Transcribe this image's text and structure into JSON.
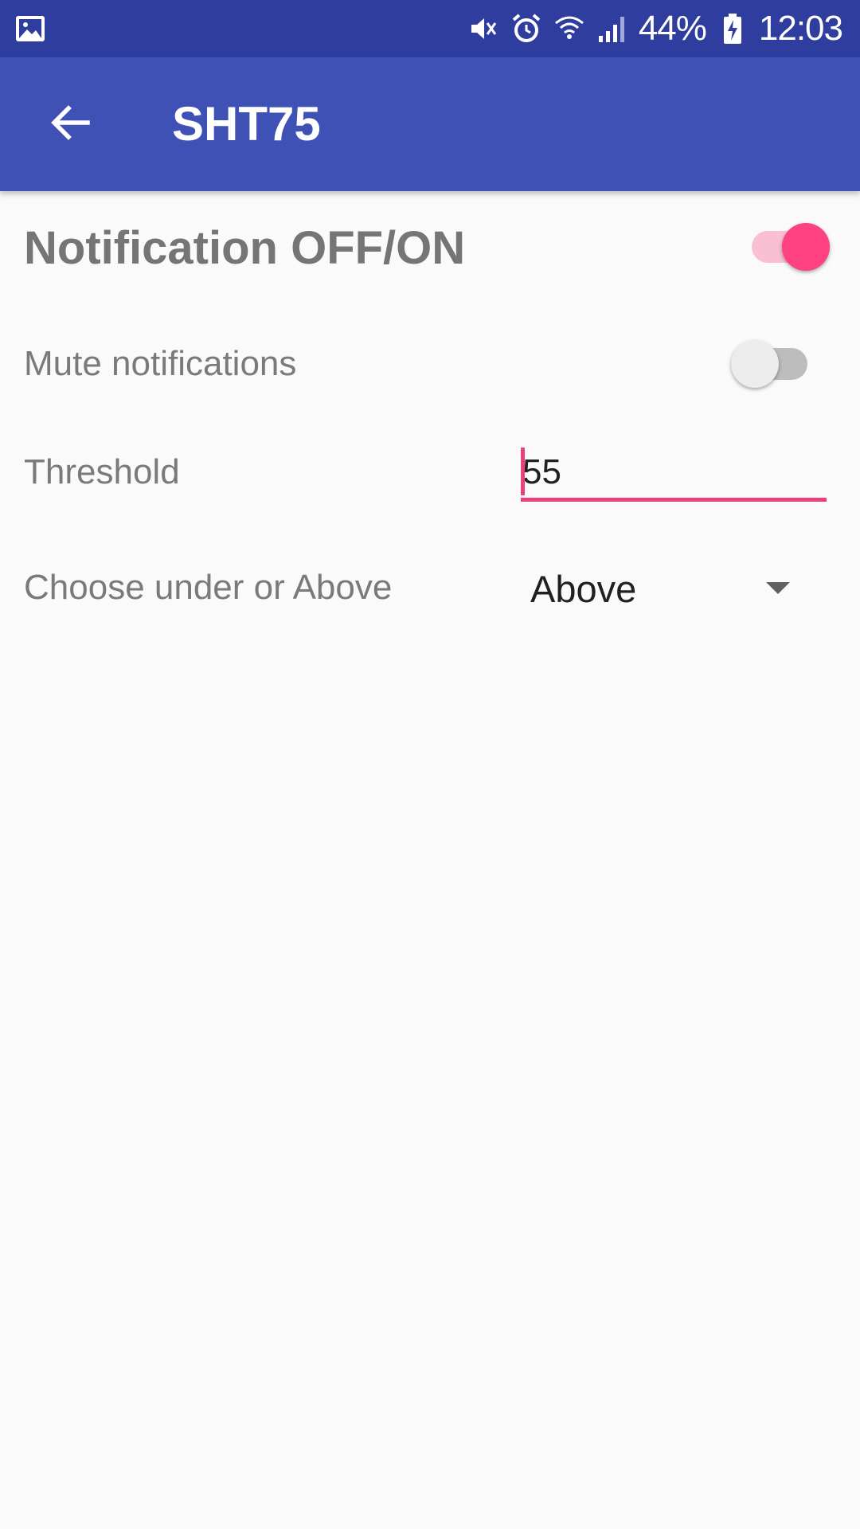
{
  "status_bar": {
    "battery_percent": "44%",
    "time": "12:03",
    "icons": [
      "gallery-icon",
      "mute-icon",
      "alarm-icon",
      "wifi-icon",
      "signal-icon",
      "battery-charging-icon"
    ]
  },
  "app_bar": {
    "title": "SHT75",
    "back_icon": "back-arrow-icon",
    "background": "#3f51b5"
  },
  "settings": {
    "notification": {
      "label": "Notification OFF/ON",
      "enabled": true
    },
    "mute": {
      "label": "Mute notifications",
      "enabled": false
    },
    "threshold": {
      "label": "Threshold",
      "value": "55"
    },
    "direction": {
      "label": "Choose under or Above",
      "selected": "Above"
    }
  },
  "colors": {
    "accent": "#ff4081",
    "status_bar": "#2f3d9f"
  }
}
